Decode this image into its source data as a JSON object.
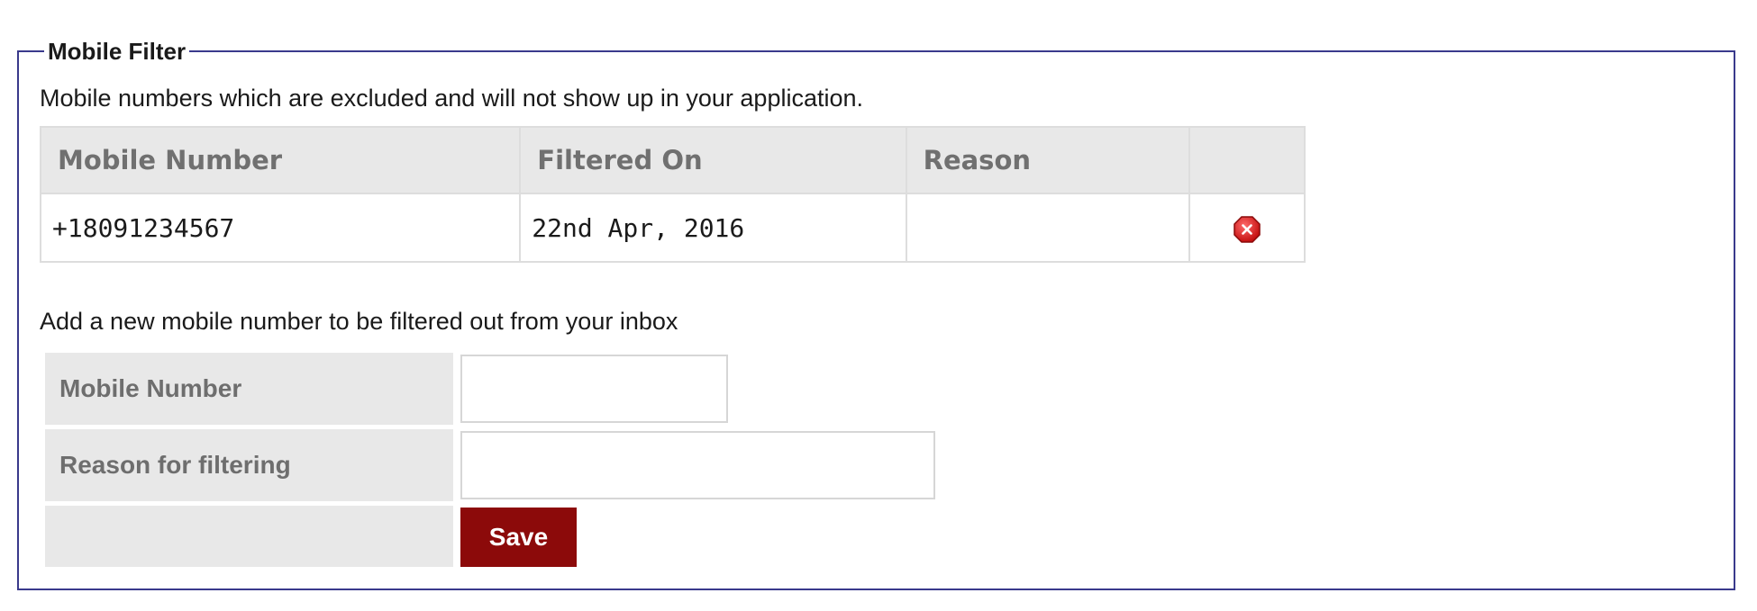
{
  "section": {
    "legend": "Mobile Filter",
    "intro": "Mobile numbers which are excluded and will not show up in your application."
  },
  "table": {
    "headers": {
      "number": "Mobile Number",
      "date": "Filtered On",
      "reason": "Reason",
      "action": ""
    },
    "rows": [
      {
        "number": "+18091234567",
        "date": "22nd Apr, 2016",
        "reason": "",
        "action_icon": "delete-icon"
      }
    ]
  },
  "add_form": {
    "intro": "Add a new mobile number to be filtered out from your inbox",
    "mobile_label": "Mobile Number",
    "mobile_value": "",
    "reason_label": "Reason for filtering",
    "reason_value": "",
    "save_label": "Save"
  },
  "colors": {
    "border": "#3a3a8c",
    "header_bg": "#e8e8e8",
    "save_button": "#8c0a0a",
    "delete_icon": "#e02020"
  }
}
